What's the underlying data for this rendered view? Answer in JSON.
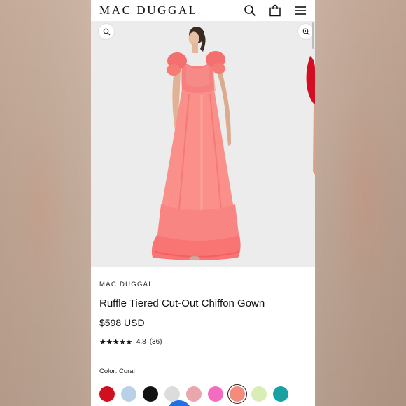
{
  "header": {
    "logo": "MAC DUGGAL"
  },
  "icons": {
    "search": "search-icon",
    "bag": "shopping-bag-icon",
    "menu": "hamburger-menu-icon",
    "zoom": "zoom-in-icon"
  },
  "product": {
    "brand": "MAC DUGGAL",
    "name": "Ruffle Tiered Cut-Out Chiffon Gown",
    "price": "$598 USD",
    "stars": "★★★★★",
    "rating": "4.8",
    "review_count": "(36)",
    "color_label": "Color: Coral"
  },
  "swatches": [
    {
      "color": "#d0101e"
    },
    {
      "color": "#b9d0e6"
    },
    {
      "color": "#121212"
    },
    {
      "color": "#dcdcdc"
    },
    {
      "color": "#e9a6ad"
    },
    {
      "color": "#f36cc0"
    },
    {
      "color": "#f58b7c",
      "selected": true
    },
    {
      "color": "#d8eeb6"
    },
    {
      "color": "#17a1a4"
    }
  ],
  "colors": {
    "dress": "#f87f7e",
    "dress_light": "#fba79d",
    "gallery_bg": "#ececec"
  }
}
